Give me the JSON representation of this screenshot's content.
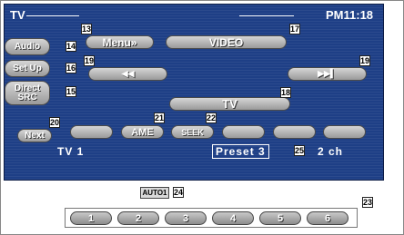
{
  "header": {
    "source": "TV",
    "clock": "PM11:18"
  },
  "side_buttons": [
    {
      "label": "Audio"
    },
    {
      "label": "Set Up"
    },
    {
      "label": "Direct SRC"
    }
  ],
  "top_buttons": {
    "menu": "Menu»",
    "video": "VIDEO"
  },
  "seek_buttons": {
    "prev": "⧏⧏",
    "next": "▸▸▏"
  },
  "source_button": "TV",
  "next_button": "Next",
  "function_buttons": [
    "",
    "AME",
    "SEEK",
    "",
    "",
    ""
  ],
  "status": {
    "band": "TV 1",
    "preset": "Preset 3",
    "channel": "2 ch"
  },
  "auto_indicator": "AUTO1",
  "preset_buttons": [
    "1",
    "2",
    "3",
    "4",
    "5",
    "6"
  ],
  "callouts": {
    "c13": "13",
    "c14": "14",
    "c15": "15",
    "c16": "16",
    "c17": "17",
    "c18": "18",
    "c19a": "19",
    "c19b": "19",
    "c20": "20",
    "c21": "21",
    "c22": "22",
    "c23": "23",
    "c24": "24",
    "c25": "25"
  }
}
